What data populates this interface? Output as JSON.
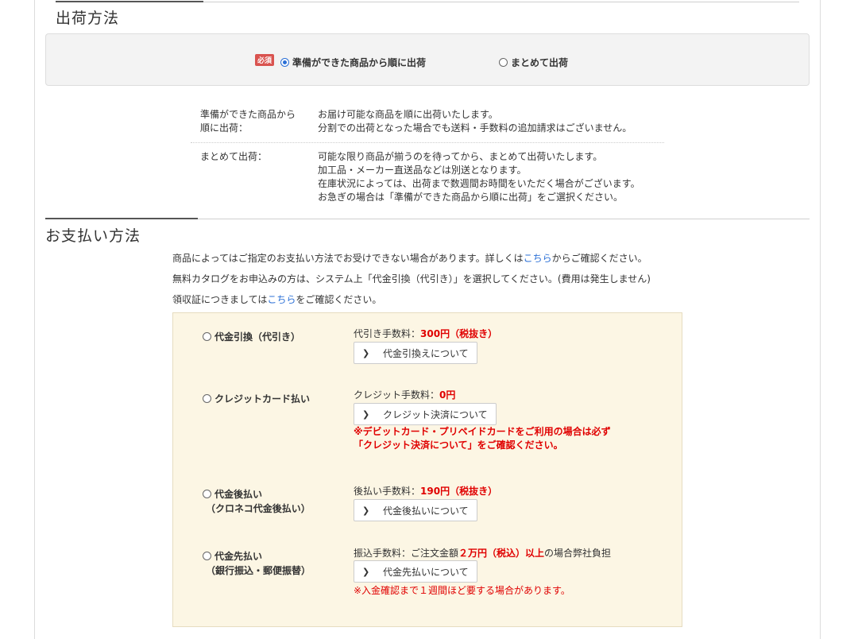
{
  "shipping": {
    "title": "出荷方法",
    "required_badge": "必須",
    "option_sequential": "準備ができた商品から順に出荷",
    "option_together": "まとめて出荷",
    "descriptions": [
      {
        "label_line1": "準備ができた商品から",
        "label_line2": "順に出荷：",
        "lines": [
          "お届け可能な商品を順に出荷いたします。",
          "分割での出荷となった場合でも送料・手数料の追加請求はございません。"
        ]
      },
      {
        "label_line1": "まとめて出荷：",
        "lines": [
          "可能な限り商品が揃うのを待ってから、まとめて出荷いたします。",
          "加工品・メーカー直送品などは別送となります。",
          "在庫状況によっては、出荷まで数週間お時間をいただく場合がございます。",
          "お急ぎの場合は「準備ができた商品から順に出荷」をご選択ください。"
        ]
      }
    ]
  },
  "payment": {
    "title": "お支払い方法",
    "note1_before": "商品によってはご指定のお支払い方法でお受けできない場合があります。詳しくは",
    "note1_link": "こちら",
    "note1_after": "からご確認ください。",
    "note2": "無料カタログをお申込みの方は、システム上「代金引換（代引き）」を選択してください。(費用は発生しません)",
    "note3_before": "領収証につきましては",
    "note3_link": "こちら",
    "note3_after": "をご確認ください。",
    "methods": [
      {
        "label": "代金引換（代引き）",
        "fee_label": "代引き手数料：",
        "fee_value": "300円（税抜き）",
        "button": "代金引換えについて"
      },
      {
        "label": "クレジットカード払い",
        "fee_label": "クレジット手数料：",
        "fee_value": "0円",
        "button": "クレジット決済について",
        "warning_line1": "※デビットカード・プリペイドカードをご利用の場合は必ず",
        "warning_line2": "「クレジット決済について」をご確認ください。"
      },
      {
        "label": "代金後払い",
        "label_line2": "（クロネコ代金後払い）",
        "fee_label": "後払い手数料：",
        "fee_value": "190円（税抜き）",
        "button": "代金後払いについて"
      },
      {
        "label": "代金先払い",
        "label_line2": "（銀行振込・郵便振替）",
        "fee_label": "振込手数料：ご注文金額",
        "fee_value": "２万円（税込）以上",
        "fee_after": "の場合弊社負担",
        "button": "代金先払いについて",
        "warning": "※入金確認まで１週間ほど要する場合があります。"
      }
    ]
  },
  "colors": {
    "accent_red": "#e00000",
    "link_blue": "#2a6fd6",
    "payment_bg": "#fcf6e4",
    "badge_red": "#d9534f"
  }
}
